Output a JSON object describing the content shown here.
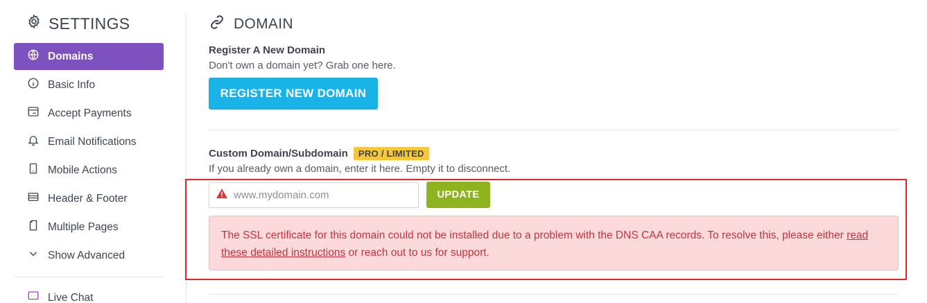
{
  "sidebar": {
    "title": "SETTINGS",
    "items": [
      {
        "label": "Domains",
        "icon": "globe-icon",
        "active": true
      },
      {
        "label": "Basic Info",
        "icon": "info-icon"
      },
      {
        "label": "Accept Payments",
        "icon": "card-icon"
      },
      {
        "label": "Email Notifications",
        "icon": "bell-icon"
      },
      {
        "label": "Mobile Actions",
        "icon": "mobile-icon"
      },
      {
        "label": "Header & Footer",
        "icon": "layout-icon"
      },
      {
        "label": "Multiple Pages",
        "icon": "pages-icon"
      },
      {
        "label": "Show Advanced",
        "icon": "chevron-down-icon"
      }
    ],
    "live_chat": {
      "label": "Live Chat",
      "icon": "chat-icon"
    }
  },
  "main": {
    "title": "DOMAIN",
    "register": {
      "heading": "Register A New Domain",
      "subtitle": "Don't own a domain yet? Grab one here.",
      "button": "REGISTER NEW DOMAIN"
    },
    "custom": {
      "heading": "Custom Domain/Subdomain",
      "badge": "PRO / LIMITED",
      "subtitle": "If you already own a domain, enter it here. Empty it to disconnect.",
      "input_value": "",
      "input_placeholder": "www.mydomain.com",
      "update_button": "UPDATE"
    },
    "alert": {
      "text_before": "The SSL certificate for this domain could not be installed due to a problem with the DNS CAA records. To resolve this, please either ",
      "link_text": "read these detailed instructions",
      "text_after": " or reach out to us for support."
    }
  },
  "colors": {
    "accent_purple": "#7d52be",
    "register_blue": "#1ab3e8",
    "update_green": "#8fb31f",
    "badge_yellow": "#f6c73b",
    "error_red": "#e0262b",
    "alert_bg": "#fcdadc"
  }
}
